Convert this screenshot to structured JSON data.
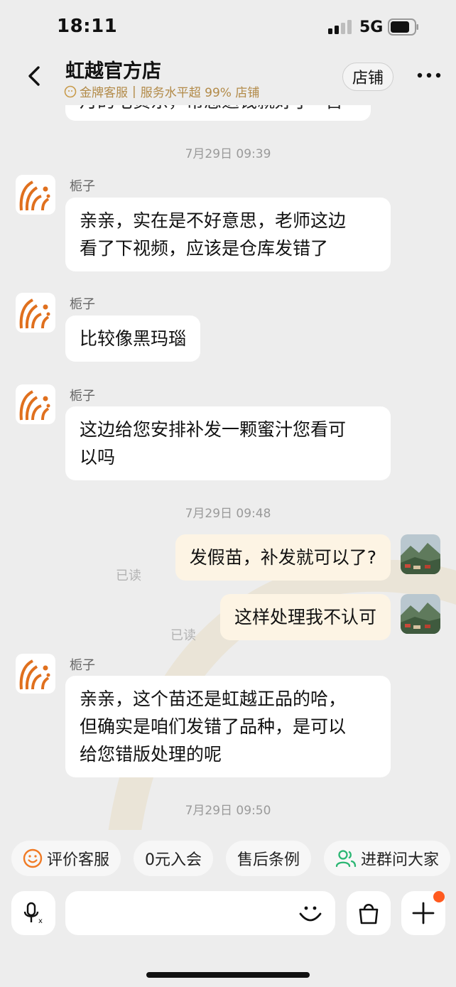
{
  "status_bar": {
    "time": "18:11",
    "network": "5G"
  },
  "header": {
    "title": "虹越官方店",
    "badge": "金牌客服",
    "service_text": "服务水平超 99% 店铺",
    "store_button": "店铺"
  },
  "chat": {
    "partial_text": "月的宅货东，帮您退钱就好了~吾",
    "messages": [
      {
        "type": "time",
        "text": "7月29日 09:39"
      },
      {
        "type": "in",
        "sender": "栀子",
        "lines": [
          "亲亲，实在是不好意思，老师这边",
          "看了下视频，应该是仓库发错了"
        ]
      },
      {
        "type": "in",
        "sender": "栀子",
        "lines": [
          "比较像黑玛瑙"
        ]
      },
      {
        "type": "in",
        "sender": "栀子",
        "lines": [
          "这边给您安排补发一颗蜜汁您看可",
          "以吗"
        ]
      },
      {
        "type": "time",
        "text": "7月29日 09:48"
      },
      {
        "type": "out",
        "text": "发假苗，补发就可以了?",
        "status": "已读"
      },
      {
        "type": "out",
        "text": "这样处理我不认可",
        "status": "已读"
      },
      {
        "type": "in",
        "sender": "栀子",
        "lines": [
          "亲亲，这个苗还是虹越正品的哈，",
          "但确实是咱们发错了品种，是可以",
          "给您错版处理的呢"
        ]
      },
      {
        "type": "time",
        "text": "7月29日 09:50"
      }
    ]
  },
  "quick_actions": [
    {
      "label": "评价客服",
      "icon": "smiley-icon"
    },
    {
      "label": "0元入会"
    },
    {
      "label": "售后条例"
    },
    {
      "label": "进群问大家",
      "icon": "group-icon"
    }
  ],
  "input": {
    "placeholder": ""
  },
  "colors": {
    "bubble_out": "#fdf4e4",
    "bubble_in": "#ffffff",
    "gold": "#b28a48",
    "accent": "#ff5a1f",
    "brand_logo": "#e0701e",
    "green": "#2bb673"
  }
}
